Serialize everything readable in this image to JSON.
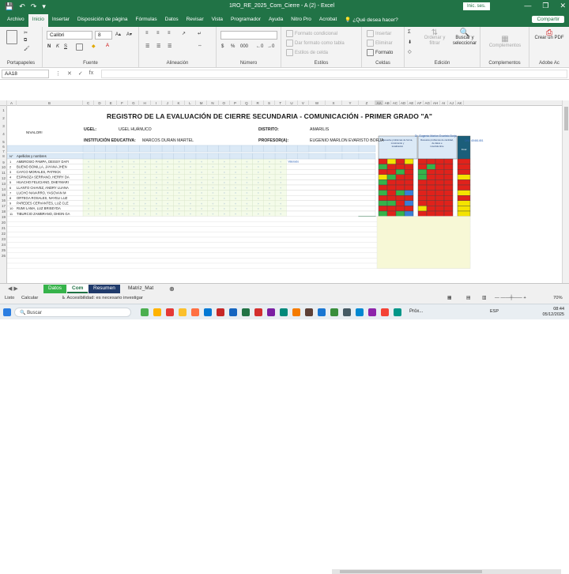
{
  "titlebar": {
    "title": "1RO_RE_2025_Com_Cierre - A (2)  -  Excel",
    "signin": "Inic. ses.",
    "qat": [
      "💾",
      "↶",
      "↷",
      "▾"
    ],
    "winctl": [
      "—",
      "❐",
      "✕"
    ]
  },
  "menu": {
    "tabs": [
      "Archivo",
      "Inicio",
      "Insertar",
      "Disposición de página",
      "Fórmulas",
      "Datos",
      "Revisar",
      "Vista",
      "Programador",
      "Ayuda",
      "Nitro Pro",
      "Acrobat",
      "💡 ¿Qué desea hacer?"
    ],
    "share": "Compartir"
  },
  "ribbon": {
    "portapapeles": "Portapapeles",
    "fuente": "Fuente",
    "font_name": "Calibri",
    "font_size": "8",
    "bold": "N",
    "italic": "K",
    "underline": "S",
    "alineacion": "Alineación",
    "numero": "Número",
    "estilos": "Estilos",
    "formato_condicional": "Formato condicional",
    "dar_formato_tabla": "Dar formato como tabla",
    "estilos_celda": "Estilos de celda",
    "celdas": "Celdas",
    "insertar": "Insertar",
    "eliminar": "Eliminar",
    "formato": "Formato",
    "edicion": "Edición",
    "ordenar": "Ordenar y filtrar",
    "buscar": "Buscar y seleccionar",
    "complementos": "Complementos",
    "complementos_btn": "Complementos",
    "crear_pdf": "Crear un PDF",
    "adobe": "Adobe Ac"
  },
  "formula_bar": {
    "name_box": "AA18",
    "icons": [
      "⋮",
      "✕",
      "✓",
      "fx"
    ],
    "value": ""
  },
  "sheet": {
    "title": "REGISTRO DE LA EVALUACIÓN DE CIERRE SECUNDARIA - COMUNICACIÓN - PRIMER GRADO \"A\"",
    "nivel": "NIVALOR!",
    "ugel_label": "UGEL:",
    "ugel_value": "UGEL HUÁNUCO",
    "ie_label": "INSTITUCIÓN EDUCATIVA:",
    "ie_value": "MARCOS DURAN MARTEL",
    "distrito_label": "DISTRITO:",
    "distrito_value": "AMARILIS",
    "profesor_label": "PROFESOR(A):",
    "profesor_value": "EUGENIO MARLON EVARISTO BORJA",
    "col_no": "N°",
    "col_names": "Apellidos y nombres",
    "students": [
      "AMBROSIO PAMPA, DEISSY DAFI",
      "BUENO BONILLA, JAYANA JHEN",
      "CAYCO MORALES, PATRICK",
      "ESPINOZA SERRANO, HERRY DA",
      "HUACHO FELICIANO, DHEYMARI",
      "LLANTO CHAVEZ, ANDRY LUANA",
      "LUCHO NAVARRO, YASOVAN M",
      "ORTEGA ROSALES, NAYELI LUZ",
      "PAREDES CERVANTES, LUZ CLE",
      "RUMI LAMA, LUZ BRISEYDA",
      "TIBURCIO ZAMBRANO, DHEIN GA"
    ],
    "row_numbers": [
      "1",
      "2",
      "3",
      "4",
      "5",
      "6",
      "7",
      "8",
      "9",
      "10",
      "11"
    ],
    "extra_text": "Valorado",
    "side_note1": "Dr. Eugenio Marlon Evaristo Borja",
    "side_note2": "DNI: 40461451",
    "result_head1": "Resuelve problemas de forma, movimiento y localización",
    "result_head2": "Resuelve problemas de cantidad, de datos e incertidumbre",
    "final_head": "Final"
  },
  "col_letters": [
    "A",
    "B",
    "C",
    "D",
    "E",
    "F",
    "G",
    "H",
    "I",
    "J",
    "K",
    "L",
    "M",
    "N",
    "O",
    "P",
    "Q",
    "R",
    "S",
    "T",
    "U",
    "V",
    "W",
    "X",
    "Y",
    "Z",
    "AA",
    "AB",
    "AC",
    "AD",
    "AE",
    "AF",
    "AG",
    "AH",
    "AI",
    "AJ",
    "AK"
  ],
  "row_head_numbers": [
    "1",
    "2",
    "3",
    "4",
    "5",
    "6",
    "7",
    "8",
    "9",
    "10",
    "11",
    "12",
    "13",
    "14",
    "15",
    "16",
    "17",
    "18",
    "19",
    "20",
    "21",
    "22",
    "23",
    "24",
    "25",
    "26"
  ],
  "sheet_tabs": [
    "Datos",
    "Com",
    "Resumen",
    "Matriz_Mat"
  ],
  "status": {
    "ready": "Listo",
    "calc": "Calcular",
    "accessibility": "Accesibilidad: es necesario investigar",
    "zoom": "70%"
  },
  "taskbar": {
    "search_placeholder": "Buscar",
    "app_label": "Próx...",
    "language": "ESP",
    "time": "08:44",
    "date": "05/12/2025"
  },
  "colors": {
    "excel_green": "#217346",
    "grade_red": "#e0221b",
    "grade_yellow": "#f4e300",
    "grade_green": "#36b34a",
    "grade_blue": "#3a7fd5",
    "header_lightblue": "#dbe9f6"
  }
}
